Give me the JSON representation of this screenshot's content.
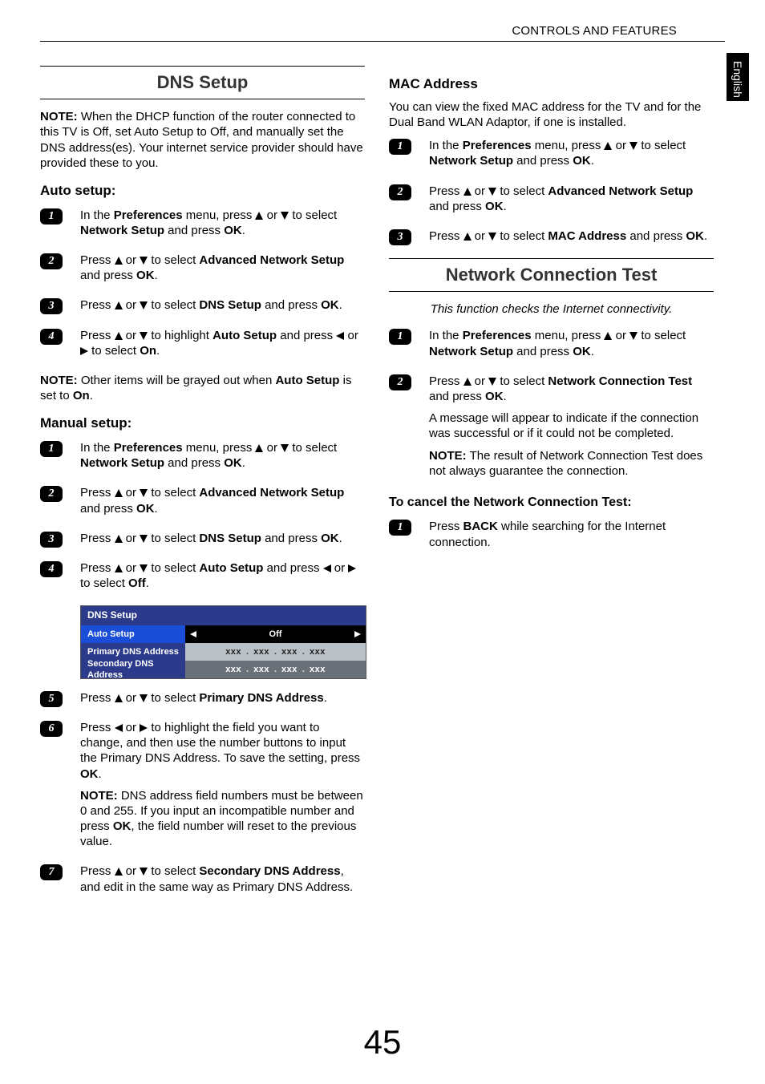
{
  "header": {
    "title": "CONTROLS AND FEATURES"
  },
  "side_tab": "English",
  "page_number": "45",
  "left": {
    "section_title": "DNS Setup",
    "intro_note_label": "NOTE:",
    "intro_note": " When the DHCP function of the router connected to this TV is Off, set Auto Setup to Off, and manually set the DNS address(es). Your internet service provider should have provided these to you.",
    "auto_setup_heading": "Auto setup:",
    "auto_steps": {
      "s1": {
        "a": "In the ",
        "b": "Preferences",
        "c": " menu, press ",
        "d": " or ",
        "e": " to select ",
        "f": "Network Setup",
        "g": " and press ",
        "h": "OK",
        "i": "."
      },
      "s2": {
        "a": "Press ",
        "b": " or ",
        "c": " to select ",
        "d": "Advanced Network Setup",
        "e": " and press ",
        "f": "OK",
        "g": "."
      },
      "s3": {
        "a": "Press ",
        "b": " or ",
        "c": " to select ",
        "d": "DNS Setup",
        "e": " and press ",
        "f": "OK",
        "g": "."
      },
      "s4": {
        "a": "Press ",
        "b": " or ",
        "c": " to highlight ",
        "d": "Auto Setup",
        "e": " and press ",
        "f": " or ",
        "g": " to select ",
        "h": "On",
        "i": "."
      }
    },
    "auto_note_label": "NOTE:",
    "auto_note_a": " Other items will be grayed out when ",
    "auto_note_b": "Auto Setup",
    "auto_note_c": " is set to ",
    "auto_note_d": "On",
    "auto_note_e": ".",
    "manual_setup_heading": "Manual setup:",
    "manual_steps": {
      "s1": {
        "a": "In the ",
        "b": "Preferences",
        "c": " menu, press ",
        "d": " or ",
        "e": " to select ",
        "f": "Network Setup",
        "g": " and press ",
        "h": "OK",
        "i": "."
      },
      "s2": {
        "a": "Press ",
        "b": " or ",
        "c": " to select ",
        "d": "Advanced Network Setup",
        "e": " and press ",
        "f": "OK",
        "g": "."
      },
      "s3": {
        "a": "Press ",
        "b": " or ",
        "c": " to select ",
        "d": "DNS Setup",
        "e": " and press ",
        "f": "OK",
        "g": "."
      },
      "s4": {
        "a": "Press ",
        "b": " or ",
        "c": " to select ",
        "d": "Auto Setup",
        "e": " and press ",
        "f": " or ",
        "g": " to select ",
        "h": "Off",
        "i": "."
      },
      "s5": {
        "a": "Press ",
        "b": " or ",
        "c": " to select ",
        "d": "Primary DNS Address",
        "e": "."
      },
      "s6": {
        "a": "Press ",
        "b": " or ",
        "c": " to highlight the field you want to change, and then use the number buttons to input the Primary DNS Address. To save the setting, press ",
        "d": "OK",
        "e": ".",
        "note_label": "NOTE:",
        "note_a": " DNS address field numbers must be between 0 and 255. If you input an incompatible number and press ",
        "note_b": "OK",
        "note_c": ", the field number will reset to the previous value."
      },
      "s7": {
        "a": "Press ",
        "b": " or ",
        "c": " to select ",
        "d": "Secondary DNS Address",
        "e": ", and edit in the same way as Primary DNS Address."
      }
    },
    "dns_table": {
      "title": "DNS Setup",
      "row_auto": {
        "label": "Auto Setup",
        "value": "Off"
      },
      "row_pri": {
        "label": "Primary DNS Address",
        "v1": "xxx",
        "v2": "xxx",
        "v3": "xxx",
        "v4": "xxx"
      },
      "row_sec": {
        "label": "Secondary DNS Address",
        "v1": "xxx",
        "v2": "xxx",
        "v3": "xxx",
        "v4": "xxx"
      }
    }
  },
  "right": {
    "mac_heading": "MAC Address",
    "mac_intro": "You can view the fixed MAC address for the TV and for the Dual Band WLAN Adaptor, if one is installed.",
    "mac_steps": {
      "s1": {
        "a": "In the ",
        "b": "Preferences",
        "c": " menu, press ",
        "d": " or ",
        "e": " to select ",
        "f": "Network Setup",
        "g": " and press ",
        "h": "OK",
        "i": "."
      },
      "s2": {
        "a": "Press ",
        "b": " or ",
        "c": " to select ",
        "d": "Advanced Network Setup",
        "e": " and press ",
        "f": "OK",
        "g": "."
      },
      "s3": {
        "a": "Press ",
        "b": " or ",
        "c": " to select ",
        "d": "MAC Address",
        "e": " and press ",
        "f": "OK",
        "g": "."
      }
    },
    "nct_title": "Network Connection Test",
    "nct_italic": "This function checks the Internet connectivity.",
    "nct_steps": {
      "s1": {
        "a": "In the ",
        "b": "Preferences",
        "c": " menu, press ",
        "d": " or ",
        "e": " to select ",
        "f": "Network Setup",
        "g": " and press ",
        "h": "OK",
        "i": "."
      },
      "s2": {
        "a": "Press ",
        "b": " or ",
        "c": " to select ",
        "d": "Network Connection Test",
        "e": " and press ",
        "f": "OK",
        "g": ".",
        "msg": "A message will appear to indicate if the connection was successful or if it could not be completed.",
        "note_label": "NOTE:",
        "note": " The result of Network Connection Test does not always guarantee the connection."
      }
    },
    "cancel_heading": "To cancel the Network Connection Test:",
    "cancel_steps": {
      "s1": {
        "a": "Press ",
        "b": "BACK",
        "c": " while searching for the Internet connection."
      }
    }
  }
}
